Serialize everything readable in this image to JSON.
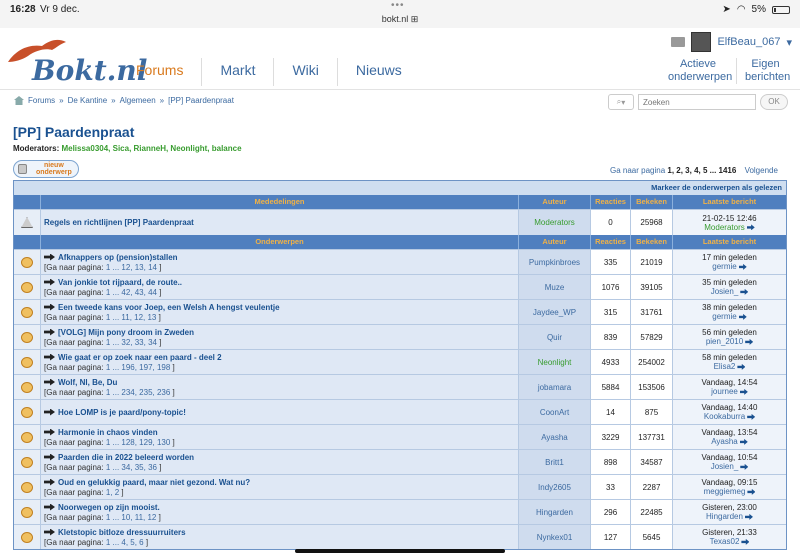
{
  "status": {
    "time": "16:28",
    "date": "Vr 9 dec.",
    "url": "bokt.nl",
    "battery": "5%"
  },
  "header": {
    "logo_text": "Bokt.nl",
    "nav": [
      "Forums",
      "Markt",
      "Wiki",
      "Nieuws"
    ],
    "active_nav": "Forums",
    "username": "ElfBeau_067",
    "link_active_topics": "Actieve onderwerpen",
    "link_own_replies": "Eigen berichten"
  },
  "breadcrumb": [
    "Forums",
    "De Kantine",
    "Algemeen",
    "[PP] Paardenpraat"
  ],
  "search": {
    "placeholder": "Zoeken",
    "ok": "OK"
  },
  "page": {
    "title": "[PP] Paardenpraat",
    "moderators_label": "Moderators:",
    "moderators": "Melissa0304, Sica, RianneH, Neonlight, balance",
    "new_topic_label": "nieuw onderwerp",
    "pagination_prefix": "Ga naar pagina",
    "pagination_pages": "1, 2, 3, 4, 5 ... 1416",
    "pagination_next": "Volgende"
  },
  "table": {
    "mark_read": "Markeer de onderwerpen als gelezen",
    "ann_headers": [
      "Mededelingen",
      "Auteur",
      "Reacties",
      "Bekeken",
      "Laatste bericht"
    ],
    "topic_headers": [
      "Onderwerpen",
      "Auteur",
      "Reacties",
      "Bekeken",
      "Laatste bericht"
    ],
    "announcements": [
      {
        "title": "Regels en richtlijnen [PP] Paardenpraat",
        "author": "Moderators",
        "author_color": "#389c2f",
        "replies": "0",
        "views": "25968",
        "last_when": "21-02-15 12:46",
        "last_who": "Moderators",
        "last_who_color": "#389c2f"
      }
    ],
    "topics": [
      {
        "title": "Afknappers op (pension)stallen",
        "pages": "1 ... 12, 13, 14",
        "author": "Pumpkinbroes",
        "replies": "335",
        "views": "21019",
        "last_when": "17 min geleden",
        "last_who": "germie"
      },
      {
        "title": "Van jonkie tot rijpaard, de route..",
        "pages": "1 ... 42, 43, 44",
        "author": "Muze",
        "replies": "1076",
        "views": "39105",
        "last_when": "35 min geleden",
        "last_who": "Josien_"
      },
      {
        "title": "Een tweede kans voor Joep, een Welsh A hengst veulentje",
        "pages": "1 ... 11, 12, 13",
        "author": "Jaydee_WP",
        "replies": "315",
        "views": "31761",
        "last_when": "38 min geleden",
        "last_who": "germie"
      },
      {
        "title": "[VOLG] Mijn pony droom in Zweden",
        "pages": "1 ... 32, 33, 34",
        "author": "Quir",
        "replies": "839",
        "views": "57829",
        "last_when": "56 min geleden",
        "last_who": "pien_2010"
      },
      {
        "title": "Wie gaat er op zoek naar een paard - deel 2",
        "pages": "1 ... 196, 197, 198",
        "author": "Neonlight",
        "author_color": "#389c2f",
        "replies": "4933",
        "views": "254002",
        "last_when": "58 min geleden",
        "last_who": "Elisa2"
      },
      {
        "title": "Wolf, Nl, Be, Du",
        "pages": "1 ... 234, 235, 236",
        "author": "jobamara",
        "replies": "5884",
        "views": "153506",
        "last_when": "Vandaag, 14:54",
        "last_who": "journee"
      },
      {
        "title": "Hoe LOMP is je paard/pony-topic!",
        "pages": "",
        "author": "CoonArt",
        "replies": "14",
        "views": "875",
        "last_when": "Vandaag, 14:40",
        "last_who": "Kookaburra"
      },
      {
        "title": "Harmonie in chaos vinden",
        "pages": "1 ... 128, 129, 130",
        "author": "Ayasha",
        "replies": "3229",
        "views": "137731",
        "last_when": "Vandaag, 13:54",
        "last_who": "Ayasha"
      },
      {
        "title": "Paarden die in 2022 beleerd worden",
        "pages": "1 ... 34, 35, 36",
        "author": "Britt1",
        "replies": "898",
        "views": "34587",
        "last_when": "Vandaag, 10:54",
        "last_who": "Josien_"
      },
      {
        "title": "Oud en gelukkig paard, maar niet gezond. Wat nu?",
        "pages": "1, 2",
        "author": "Indy2605",
        "replies": "33",
        "views": "2287",
        "last_when": "Vandaag, 09:15",
        "last_who": "meggiemeg"
      },
      {
        "title": "Noorwegen op zijn mooist.",
        "pages": "1 ... 10, 11, 12",
        "author": "Hingarden",
        "replies": "296",
        "views": "22485",
        "last_when": "Gisteren, 23:00",
        "last_who": "Hingarden"
      },
      {
        "title": "Kletstopic bitloze dressuurruiters",
        "pages": "1 ... 4, 5, 6",
        "author": "Nynkex01",
        "replies": "127",
        "views": "5645",
        "last_when": "Gisteren, 21:33",
        "last_who": "Texas02"
      }
    ],
    "go_to_page": "[Ga naar pagina:"
  }
}
